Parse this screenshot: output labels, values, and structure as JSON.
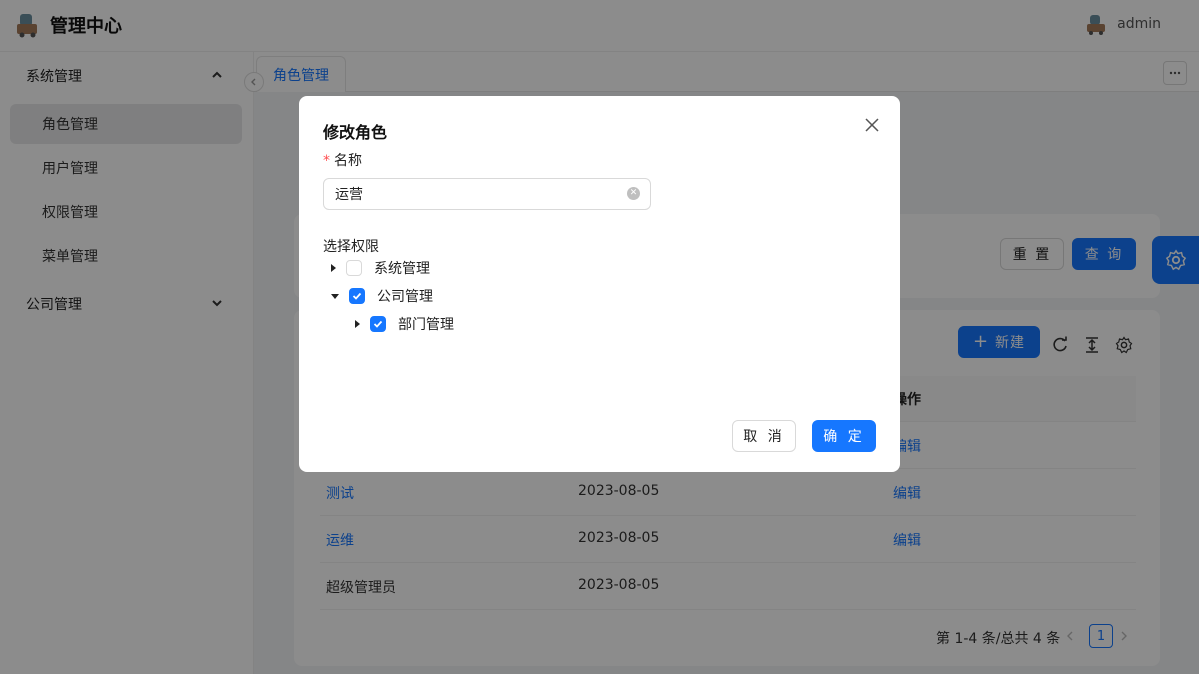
{
  "app": {
    "title": "管理中心",
    "user": "admin"
  },
  "sidebar": {
    "groups": [
      {
        "label": "系统管理",
        "expanded": true,
        "items": [
          {
            "label": "角色管理",
            "active": true
          },
          {
            "label": "用户管理",
            "active": false
          },
          {
            "label": "权限管理",
            "active": false
          },
          {
            "label": "菜单管理",
            "active": false
          }
        ]
      },
      {
        "label": "公司管理",
        "expanded": false,
        "items": []
      }
    ]
  },
  "tabs": [
    {
      "label": "角色管理",
      "active": true
    }
  ],
  "search": {
    "reset_label": "重 置",
    "query_label": "查 询"
  },
  "table": {
    "new_label": "新建",
    "columns": {
      "action": "操作"
    },
    "rows": [
      {
        "name": "",
        "date": "",
        "action": "编辑"
      },
      {
        "name": "测试",
        "date": "2023-08-05",
        "action": "编辑"
      },
      {
        "name": "运维",
        "date": "2023-08-05",
        "action": "编辑"
      },
      {
        "name": "超级管理员",
        "date": "2023-08-05",
        "action": ""
      }
    ],
    "pagination": {
      "summary": "第 1-4 条/总共 4 条",
      "current_page": "1"
    }
  },
  "modal": {
    "title": "修改角色",
    "name_label": "名称",
    "name_value": "运营",
    "permissions_label": "选择权限",
    "tree": [
      {
        "label": "系统管理",
        "checked": false,
        "expanded": false,
        "level": 0
      },
      {
        "label": "公司管理",
        "checked": true,
        "expanded": true,
        "level": 0
      },
      {
        "label": "部门管理",
        "checked": true,
        "expanded": false,
        "level": 1
      }
    ],
    "cancel_label": "取 消",
    "ok_label": "确 定"
  },
  "colors": {
    "primary": "#1677ff",
    "required": "#ff4d4f",
    "mask": "rgba(0,0,0,0.45)"
  }
}
